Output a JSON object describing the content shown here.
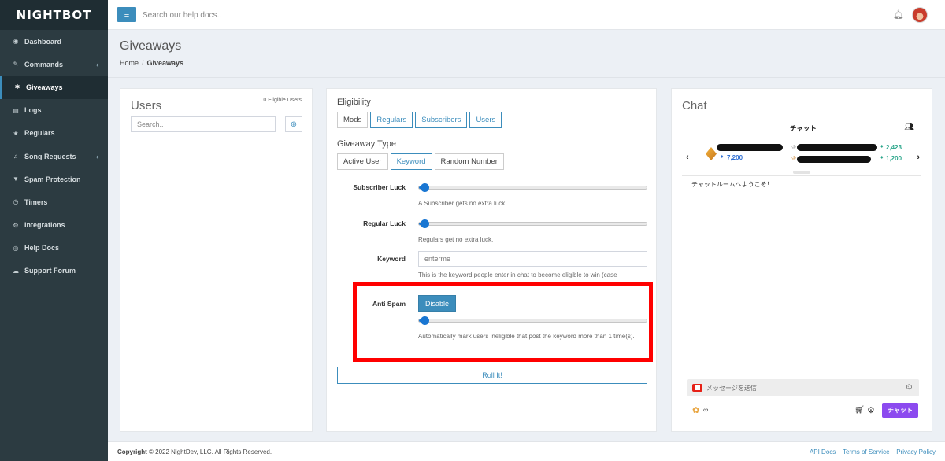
{
  "brand": "NIGHTBOT",
  "sidebar": {
    "items": [
      {
        "label": "Dashboard",
        "icon": "dashboard-icon",
        "glyph": "◉"
      },
      {
        "label": "Commands",
        "icon": "commands-icon",
        "glyph": "✎",
        "chevron": "‹"
      },
      {
        "label": "Giveaways",
        "icon": "gift-icon",
        "glyph": "✱"
      },
      {
        "label": "Logs",
        "icon": "logs-icon",
        "glyph": "▤"
      },
      {
        "label": "Regulars",
        "icon": "star-icon",
        "glyph": "★"
      },
      {
        "label": "Song Requests",
        "icon": "music-icon",
        "glyph": "♫",
        "chevron": "‹"
      },
      {
        "label": "Spam Protection",
        "icon": "filter-icon",
        "glyph": "▼"
      },
      {
        "label": "Timers",
        "icon": "clock-icon",
        "glyph": "◷"
      },
      {
        "label": "Integrations",
        "icon": "integrations-icon",
        "glyph": "⚙"
      },
      {
        "label": "Help Docs",
        "icon": "globe-icon",
        "glyph": "◎"
      },
      {
        "label": "Support Forum",
        "icon": "forum-icon",
        "glyph": "☁"
      }
    ],
    "active_index": 2
  },
  "topbar": {
    "search_placeholder": "Search our help docs.."
  },
  "header": {
    "title": "Giveaways",
    "breadcrumb_home": "Home",
    "breadcrumb_sep": "/",
    "breadcrumb_current": "Giveaways"
  },
  "users": {
    "title": "Users",
    "eligible_count": "0 Eligible Users",
    "search_placeholder": "Search.."
  },
  "eligibility": {
    "title": "Eligibility",
    "options": [
      "Mods",
      "Regulars",
      "Subscribers",
      "Users"
    ],
    "selected": [
      false,
      true,
      true,
      true
    ]
  },
  "giveaway_type": {
    "title": "Giveaway Type",
    "options": [
      "Active User",
      "Keyword",
      "Random Number"
    ],
    "selected": [
      false,
      true,
      false
    ]
  },
  "settings": {
    "subscriber_luck": {
      "label": "Subscriber Luck",
      "help": "A Subscriber gets no extra luck.",
      "level": 0.0
    },
    "regular_luck": {
      "label": "Regular Luck",
      "help": "Regulars get no extra luck.",
      "level": 0.0
    },
    "keyword": {
      "label": "Keyword",
      "value": "enterme",
      "help": "This is the keyword people enter in chat to become eligible to win (case"
    },
    "anti_spam": {
      "label": "Anti Spam",
      "button": "Disable",
      "help": "Automatically mark users ineligible that post the keyword more than 1 time(s).",
      "level": 0.0
    }
  },
  "roll_button": "Roll It!",
  "chat": {
    "title": "Chat",
    "header_label": "チャット",
    "left_points": "7,200",
    "right_points_1": "2,423",
    "right_points_2": "1,200",
    "welcome": "チャットルームへようこそ！",
    "message_placeholder": "メッセージを送信",
    "infinity": "∞",
    "send_label": "チャット"
  },
  "footer": {
    "copyright_bold": "Copyright",
    "copyright_rest": "© 2022 NightDev, LLC. All Rights Reserved.",
    "links": [
      "API Docs",
      "Terms of Service",
      "Privacy Policy"
    ],
    "link_sep": "·"
  },
  "colors": {
    "sidebar_bg": "#2c3b41",
    "accent": "#3c8dbc",
    "highlight_frame": "#ff0000",
    "chat_send": "#8c4aef"
  }
}
